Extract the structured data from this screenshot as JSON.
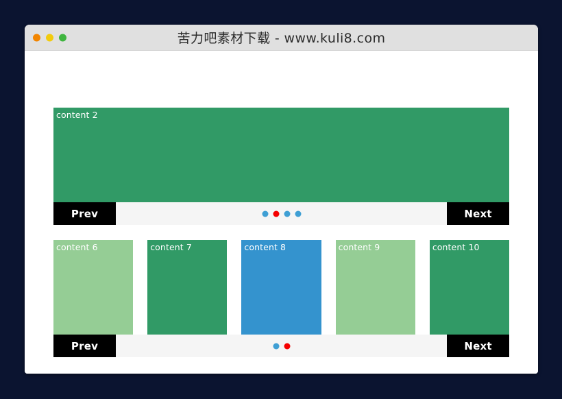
{
  "window": {
    "title": "苦力吧素材下载 - www.kuli8.com",
    "traffic_lights": [
      {
        "name": "close",
        "color": "#f28500"
      },
      {
        "name": "minimize",
        "color": "#f2cb0d"
      },
      {
        "name": "maximize",
        "color": "#3fb53f"
      }
    ]
  },
  "colors": {
    "page_background": "#0b1430",
    "window_background": "#ffffff",
    "titlebar": "#e0e0e0",
    "navbar": "#f5f5f5",
    "button": "#000000",
    "button_text": "#ffffff",
    "green": "#319a66",
    "light_green": "#95cd95",
    "blue": "#3493ce",
    "gap": "#cccccc",
    "dot_inactive": "#3f9fd4",
    "dot_active": "#f50000"
  },
  "carousels": [
    {
      "id": "top-carousel",
      "slide": {
        "label": "content 2",
        "color": "#319a66"
      },
      "nav": {
        "prev_label": "Prev",
        "next_label": "Next",
        "dots": [
          {
            "active": false
          },
          {
            "active": true
          },
          {
            "active": false
          },
          {
            "active": false
          }
        ]
      }
    },
    {
      "id": "bottom-carousel",
      "thumbs": [
        {
          "label": "content 6",
          "color": "#95cd95"
        },
        {
          "label": "content 7",
          "color": "#319a66"
        },
        {
          "label": "content 8",
          "color": "#3493ce"
        },
        {
          "label": "content 9",
          "color": "#95cd95"
        },
        {
          "label": "content 10",
          "color": "#319a66"
        }
      ],
      "nav": {
        "prev_label": "Prev",
        "next_label": "Next",
        "dots": [
          {
            "active": false
          },
          {
            "active": true
          }
        ]
      }
    }
  ]
}
